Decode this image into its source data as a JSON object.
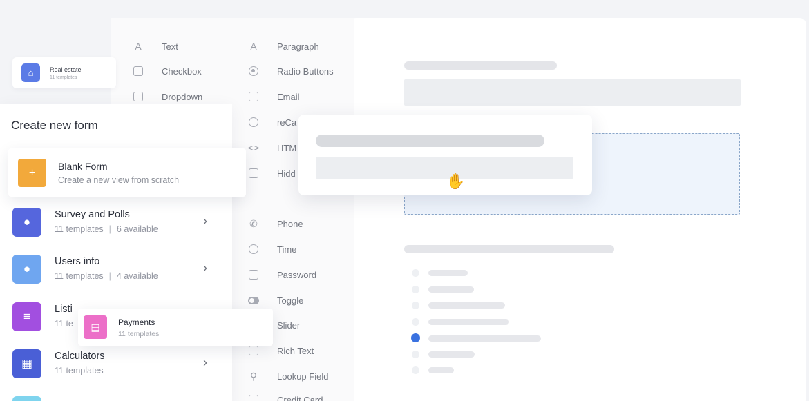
{
  "chip": {
    "label": "Real estate",
    "meta": "11 templates"
  },
  "palette": {
    "left": [
      "Text",
      "Checkbox",
      "Dropdown"
    ],
    "right": [
      "Paragraph",
      "Radio Buttons",
      "Email",
      "reCa",
      "HTM",
      "Hidd",
      "Phone",
      "Time",
      "Password",
      "Toggle",
      "Slider",
      "Rich Text",
      "Lookup Field",
      "Credit Card"
    ]
  },
  "panel": {
    "title": "Create new form",
    "blank": {
      "title": "Blank Form",
      "subtitle": "Create a new view from scratch"
    },
    "categories": [
      {
        "name": "Survey and Polls",
        "templates": "11 templates",
        "available": "6 available",
        "color": "#5566dd"
      },
      {
        "name": "Users info",
        "templates": "11 templates",
        "available": "4 available",
        "color": "#6fa6f0"
      },
      {
        "name": "Listi",
        "templates": "11 te",
        "available": "",
        "color": "#a24fe0"
      },
      {
        "name": "Calculators",
        "templates": "11 templates",
        "available": "",
        "color": "#4a5fd6"
      }
    ]
  },
  "payments": {
    "name": "Payments",
    "meta": "11 templates",
    "color": "#ec6fc8"
  },
  "colors": {
    "accent": "#3a72e0",
    "dropzone": "#eef4fc",
    "blank_icon": "#f2a93b"
  }
}
